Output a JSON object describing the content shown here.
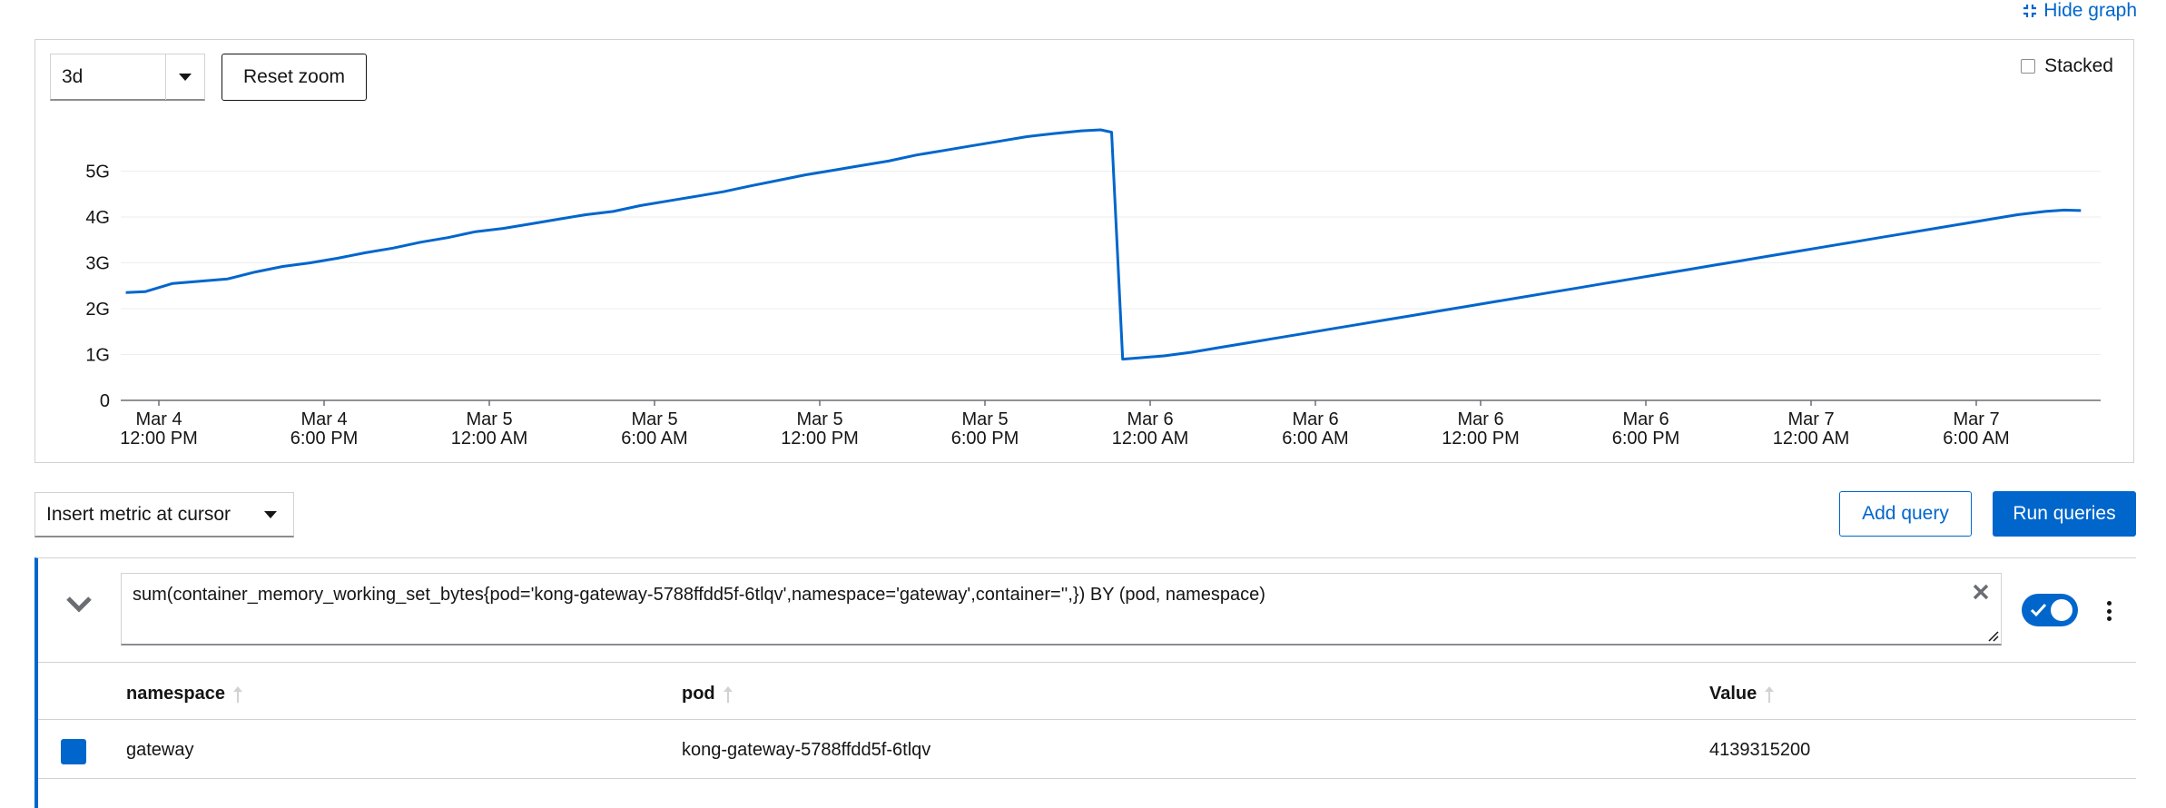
{
  "header": {
    "hide_graph_label": "Hide graph"
  },
  "graph": {
    "timespan_value": "3d",
    "reset_zoom_label": "Reset zoom",
    "stacked_label": "Stacked",
    "stacked_checked": false
  },
  "chart_data": {
    "type": "line",
    "title": "",
    "xlabel": "",
    "ylabel": "",
    "ylim": [
      0,
      6
    ],
    "yticks": [
      {
        "value": 0,
        "label": "0"
      },
      {
        "value": 1,
        "label": "1G"
      },
      {
        "value": 2,
        "label": "2G"
      },
      {
        "value": 3,
        "label": "3G"
      },
      {
        "value": 4,
        "label": "4G"
      },
      {
        "value": 5,
        "label": "5G"
      }
    ],
    "xticks": [
      {
        "line1": "Mar 4",
        "line2": "12:00 PM"
      },
      {
        "line1": "Mar 4",
        "line2": "6:00 PM"
      },
      {
        "line1": "Mar 5",
        "line2": "12:00 AM"
      },
      {
        "line1": "Mar 5",
        "line2": "6:00 AM"
      },
      {
        "line1": "Mar 5",
        "line2": "12:00 PM"
      },
      {
        "line1": "Mar 5",
        "line2": "6:00 PM"
      },
      {
        "line1": "Mar 6",
        "line2": "12:00 AM"
      },
      {
        "line1": "Mar 6",
        "line2": "6:00 AM"
      },
      {
        "line1": "Mar 6",
        "line2": "12:00 PM"
      },
      {
        "line1": "Mar 6",
        "line2": "6:00 PM"
      },
      {
        "line1": "Mar 7",
        "line2": "12:00 AM"
      },
      {
        "line1": "Mar 7",
        "line2": "6:00 AM"
      }
    ],
    "x_unit": "hours since Mar 4 12:00 PM",
    "grid": true,
    "legend": "none",
    "series": [
      {
        "color": "#0066cc",
        "points": [
          [
            -1.2,
            2.35
          ],
          [
            -0.5,
            2.37
          ],
          [
            0.5,
            2.55
          ],
          [
            1.5,
            2.6
          ],
          [
            2.5,
            2.65
          ],
          [
            3.5,
            2.8
          ],
          [
            4.5,
            2.92
          ],
          [
            5.5,
            3.0
          ],
          [
            6.5,
            3.1
          ],
          [
            7.5,
            3.22
          ],
          [
            8.5,
            3.32
          ],
          [
            9.5,
            3.45
          ],
          [
            10.5,
            3.55
          ],
          [
            11.5,
            3.68
          ],
          [
            12.5,
            3.75
          ],
          [
            13.5,
            3.85
          ],
          [
            14.5,
            3.95
          ],
          [
            15.5,
            4.05
          ],
          [
            16.5,
            4.12
          ],
          [
            17.5,
            4.25
          ],
          [
            18.5,
            4.35
          ],
          [
            19.5,
            4.45
          ],
          [
            20.5,
            4.55
          ],
          [
            21.5,
            4.68
          ],
          [
            22.5,
            4.8
          ],
          [
            23.5,
            4.92
          ],
          [
            24.5,
            5.02
          ],
          [
            25.5,
            5.12
          ],
          [
            26.5,
            5.22
          ],
          [
            27.5,
            5.35
          ],
          [
            28.5,
            5.45
          ],
          [
            29.5,
            5.55
          ],
          [
            30.5,
            5.65
          ],
          [
            31.5,
            5.75
          ],
          [
            32.5,
            5.82
          ],
          [
            33.5,
            5.88
          ],
          [
            34.2,
            5.9
          ],
          [
            34.6,
            5.85
          ],
          [
            35.0,
            0.9
          ],
          [
            36.5,
            0.97
          ],
          [
            37.5,
            1.05
          ],
          [
            38.5,
            1.15
          ],
          [
            39.5,
            1.25
          ],
          [
            40.5,
            1.35
          ],
          [
            41.5,
            1.45
          ],
          [
            42.5,
            1.55
          ],
          [
            43.5,
            1.65
          ],
          [
            44.5,
            1.75
          ],
          [
            45.5,
            1.85
          ],
          [
            46.5,
            1.95
          ],
          [
            47.5,
            2.05
          ],
          [
            48.5,
            2.15
          ],
          [
            49.5,
            2.25
          ],
          [
            50.5,
            2.35
          ],
          [
            51.5,
            2.45
          ],
          [
            52.5,
            2.55
          ],
          [
            53.5,
            2.65
          ],
          [
            54.5,
            2.75
          ],
          [
            55.5,
            2.85
          ],
          [
            56.5,
            2.95
          ],
          [
            57.5,
            3.05
          ],
          [
            58.5,
            3.15
          ],
          [
            59.5,
            3.25
          ],
          [
            60.5,
            3.35
          ],
          [
            61.5,
            3.45
          ],
          [
            62.5,
            3.55
          ],
          [
            63.5,
            3.65
          ],
          [
            64.5,
            3.75
          ],
          [
            65.5,
            3.85
          ],
          [
            66.5,
            3.95
          ],
          [
            67.5,
            4.05
          ],
          [
            68.5,
            4.12
          ],
          [
            69.2,
            4.15
          ],
          [
            69.8,
            4.14
          ]
        ]
      }
    ]
  },
  "toolbar": {
    "insert_metric_label": "Insert metric at cursor",
    "add_query_label": "Add query",
    "run_queries_label": "Run queries"
  },
  "query": {
    "expression": "sum(container_memory_working_set_bytes{pod='kong-gateway-5788ffdd5f-6tlqv',namespace='gateway',container='',}) BY (pod, namespace)",
    "enabled": true
  },
  "table": {
    "columns": [
      "namespace",
      "pod",
      "Value"
    ],
    "rows": [
      {
        "namespace": "gateway",
        "pod": "kong-gateway-5788ffdd5f-6tlqv",
        "value": "4139315200",
        "color": "#0066cc"
      }
    ]
  }
}
